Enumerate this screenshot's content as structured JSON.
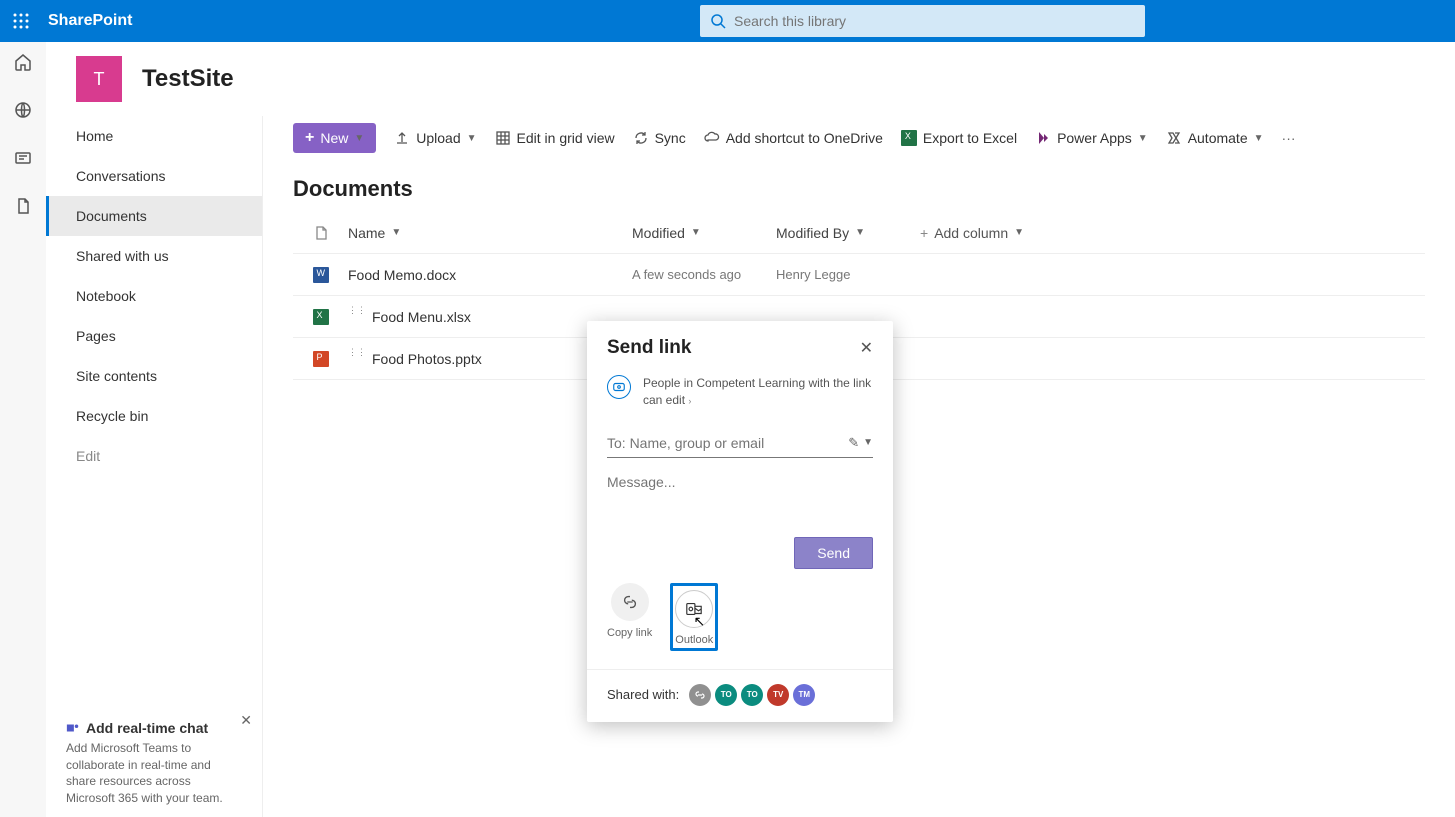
{
  "brand": "SharePoint",
  "search": {
    "placeholder": "Search this library"
  },
  "site": {
    "initial": "T",
    "name": "TestSite"
  },
  "sidenav": {
    "items": [
      "Home",
      "Conversations",
      "Documents",
      "Shared with us",
      "Notebook",
      "Pages",
      "Site contents",
      "Recycle bin"
    ],
    "edit": "Edit"
  },
  "promo": {
    "title": "Add real-time chat",
    "body": "Add Microsoft Teams to collaborate in real-time and share resources across Microsoft 365 with your team."
  },
  "cmdbar": {
    "new": "New",
    "upload": "Upload",
    "grid": "Edit in grid view",
    "sync": "Sync",
    "shortcut": "Add shortcut to OneDrive",
    "export": "Export to Excel",
    "powerapps": "Power Apps",
    "automate": "Automate"
  },
  "library": {
    "title": "Documents",
    "headers": {
      "name": "Name",
      "modified": "Modified",
      "modifiedBy": "Modified By",
      "add": "Add column"
    },
    "rows": [
      {
        "name": "Food Memo.docx",
        "type": "word",
        "modified": "A few seconds ago",
        "by": "Henry Legge"
      },
      {
        "name": "Food Menu.xlsx",
        "type": "excel",
        "modified": "",
        "by": ""
      },
      {
        "name": "Food Photos.pptx",
        "type": "ppt",
        "modified": "",
        "by": ""
      }
    ]
  },
  "dialog": {
    "title": "Send link",
    "scope": "People in Competent Learning with the link can edit",
    "to_placeholder": "To: Name, group or email",
    "msg_placeholder": "Message...",
    "send": "Send",
    "copy": "Copy link",
    "outlook": "Outlook",
    "shared": "Shared with:",
    "avatars": [
      "⊘",
      "TO",
      "TO",
      "TV",
      "TM"
    ]
  }
}
